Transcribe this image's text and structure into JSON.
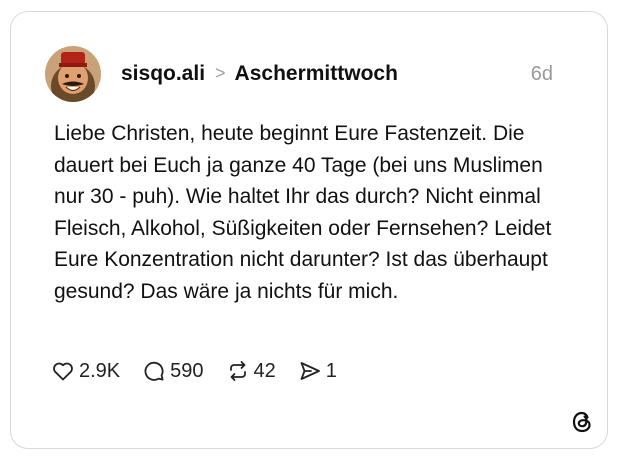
{
  "post": {
    "author": "sisqo.ali",
    "separator": ">",
    "topic": "Aschermittwoch",
    "time": "6d",
    "text": "Liebe Christen, heute beginnt Eure Fastenzeit. Die dauert bei Euch ja ganze 40 Tage (bei uns Muslimen nur 30 - puh). Wie haltet Ihr das durch? Nicht einmal Fleisch, Alkohol, Süßigkeiten oder Fernsehen? Leidet Eure Konzentration nicht darunter? Ist das überhaupt gesund? Das wäre ja nichts für mich."
  },
  "actions": {
    "likes": "2.9K",
    "replies": "590",
    "reposts": "42",
    "shares": "1"
  },
  "icons": {
    "like": "heart-icon",
    "reply": "comment-bubble-icon",
    "repost": "repost-icon",
    "share": "share-icon",
    "brand": "threads-logo-icon"
  }
}
